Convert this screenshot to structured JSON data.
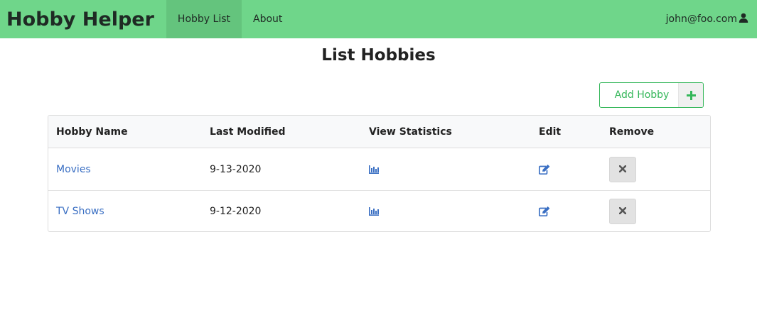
{
  "navbar": {
    "brand": "Hobby Helper",
    "links": [
      {
        "label": "Hobby List",
        "active": true
      },
      {
        "label": "About",
        "active": false
      }
    ],
    "user_email": "john@foo.com",
    "user_icon": "user-icon",
    "background_color": "#6fd68a"
  },
  "page": {
    "title": "List Hobbies",
    "add_button_label": "Add Hobby",
    "add_button_icon": "plus-icon",
    "accent_color": "#35b75a"
  },
  "table": {
    "headers": [
      "Hobby Name",
      "Last Modified",
      "View Statistics",
      "Edit",
      "Remove"
    ],
    "rows": [
      {
        "name": "Movies",
        "last_modified": "9-13-2020",
        "stats_icon": "bar-chart-icon",
        "edit_icon": "edit-icon",
        "remove_icon": "close-icon"
      },
      {
        "name": "TV Shows",
        "last_modified": "9-12-2020",
        "stats_icon": "bar-chart-icon",
        "edit_icon": "edit-icon",
        "remove_icon": "close-icon"
      }
    ],
    "link_color": "#3a6fc3"
  }
}
